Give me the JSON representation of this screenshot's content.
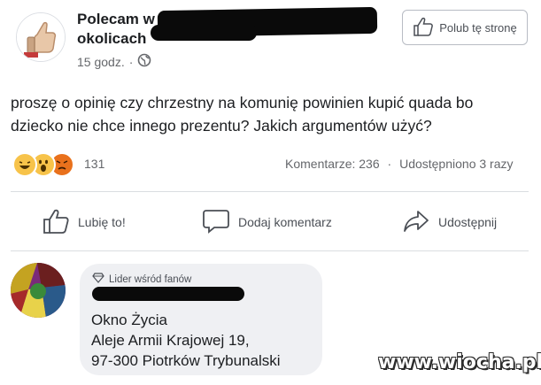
{
  "post": {
    "page_name": "Polecam w okolicach",
    "time": "15 godz.",
    "separator": "·",
    "audience_icon": "globe-icon",
    "like_page_label": "Polub tę stronę",
    "text": "proszę o opinię czy chrzestny na komunię powinien kupić quada bo dziecko nie chce innego prezentu? Jakich argumentów użyć?",
    "reaction_icons": [
      "laugh-emoji-icon",
      "wow-emoji-icon",
      "angry-emoji-icon"
    ],
    "reaction_count": "131",
    "comments_count": "Komentarze: 236",
    "stats_separator": "·",
    "shares_count": "Udostępniono 3 razy"
  },
  "actions": {
    "like": "Lubię to!",
    "comment": "Dodaj komentarz",
    "share": "Udostępnij"
  },
  "comment": {
    "badge": "Lider wśród fanów",
    "line1": "Okno Życia",
    "line2": "Aleje Armii Krajowej 19,",
    "line3": "97-300 Piotrków Trybunalski"
  },
  "watermark": "www.wiocha.pl",
  "colors": {
    "text": "#1c1e21",
    "secondary": "#65676b",
    "bubble": "#eff0f3",
    "divider": "#dadde1"
  }
}
